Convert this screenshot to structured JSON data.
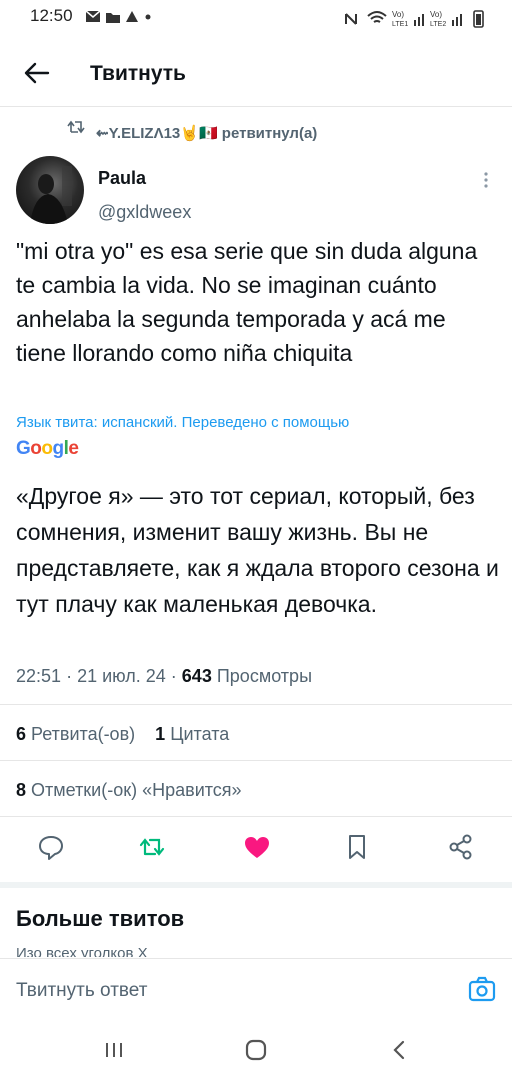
{
  "status_bar": {
    "time": "12:50",
    "sim1_label": "Vo) LTE1",
    "sim2_label": "Vo) LTE2"
  },
  "header": {
    "title": "Твитнуть"
  },
  "retweet": {
    "text": "⇜Y.ELIZΛ13🤘🇲🇽 ретвитнул(а)"
  },
  "tweet": {
    "author_name": "Paula",
    "author_handle": "@gxldweex",
    "text": "\"mi otra yo\" es esa serie que sin duda alguna te cambia la vida. No se imaginan cuánto anhelaba la segunda temporada y acá me tiene llorando como niña chiquita",
    "translate_note": "Язык твита: испанский. Переведено с помощью",
    "translate_provider": "Google",
    "translation": "«Другое я» — это тот сериал, который, без сомнения, изменит вашу жизнь. Вы не представляете, как я ждала второго сезона и тут плачу как маленькая девочка.",
    "time": "22:51",
    "date": "21 июл. 24",
    "views_count": "643",
    "views_label": "Просмотры",
    "retweets_count": "6",
    "retweets_label": "Ретвита(-ов)",
    "quotes_count": "1",
    "quotes_label": "Цитата",
    "likes_count": "8",
    "likes_label": "Отметки(-ок) «Нравится»"
  },
  "more_tweets": {
    "title": "Больше твитов",
    "subtitle": "Изо всех уголков X"
  },
  "reply": {
    "placeholder": "Твитнуть ответ"
  },
  "colors": {
    "accent": "#1d9bf0",
    "retweet_green": "#00ba7c",
    "like_pink": "#f91880",
    "muted_text": "#536471"
  },
  "icons": [
    "back-arrow-icon",
    "retweet-icon",
    "more-vertical-icon",
    "reply-icon",
    "retweet-icon",
    "heart-icon",
    "bookmark-icon",
    "share-icon",
    "camera-icon",
    "recents-icon",
    "home-icon",
    "back-icon"
  ]
}
